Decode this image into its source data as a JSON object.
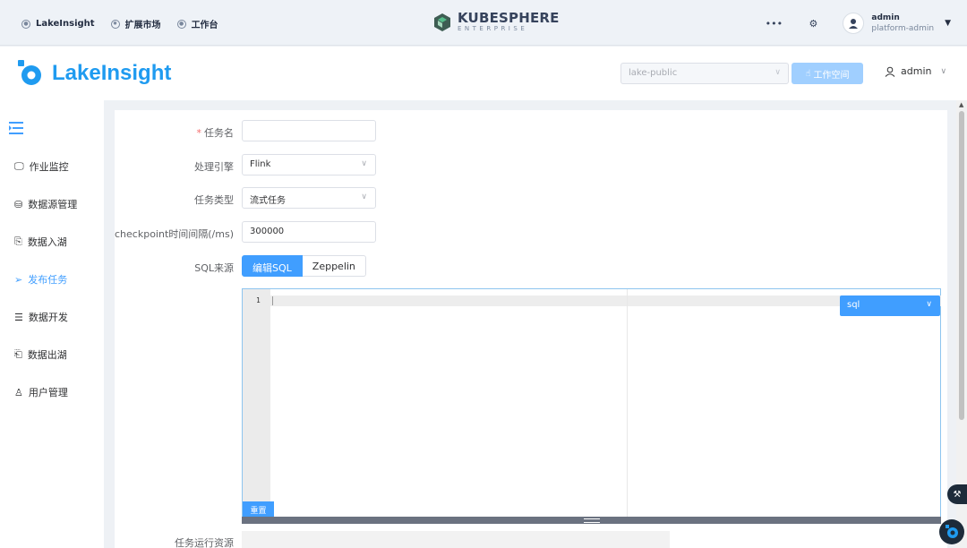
{
  "topbar": {
    "nav": [
      {
        "label": "LakeInsight",
        "icon": "circle-icon"
      },
      {
        "label": "扩展市场",
        "icon": "gear-icon"
      },
      {
        "label": "工作台",
        "icon": "circle-icon"
      }
    ],
    "logo_title": "KUBESPHERE",
    "logo_sub": "ENTERPRISE",
    "user_name": "admin",
    "user_role": "platform-admin"
  },
  "header": {
    "brand": "LakeInsight",
    "workspace_select": "lake-public",
    "workspace_button": "工作空间",
    "admin_label": "admin"
  },
  "sidebar": {
    "items": [
      {
        "label": "作业监控",
        "icon": "monitor-icon"
      },
      {
        "label": "数据源管理",
        "icon": "database-icon"
      },
      {
        "label": "数据入湖",
        "icon": "import-icon"
      },
      {
        "label": "发布任务",
        "icon": "send-icon",
        "active": true
      },
      {
        "label": "数据开发",
        "icon": "document-icon"
      },
      {
        "label": "数据出湖",
        "icon": "export-icon"
      },
      {
        "label": "用户管理",
        "icon": "user-icon"
      }
    ]
  },
  "form": {
    "task_name_label": "任务名",
    "task_name_value": "",
    "engine_label": "处理引擎",
    "engine_value": "Flink",
    "task_type_label": "任务类型",
    "task_type_value": "流式任务",
    "checkpoint_label": "checkpoint时间间隔(/ms)",
    "checkpoint_value": "300000",
    "sql_source_label": "SQL来源",
    "sql_source_options": [
      "编辑SQL",
      "Zeppelin"
    ],
    "resources_label": "任务运行资源"
  },
  "editor": {
    "line_number": "1",
    "language": "sql",
    "reset_label": "重置"
  },
  "colors": {
    "primary": "#409eff",
    "brand": "#1f9bf0"
  }
}
